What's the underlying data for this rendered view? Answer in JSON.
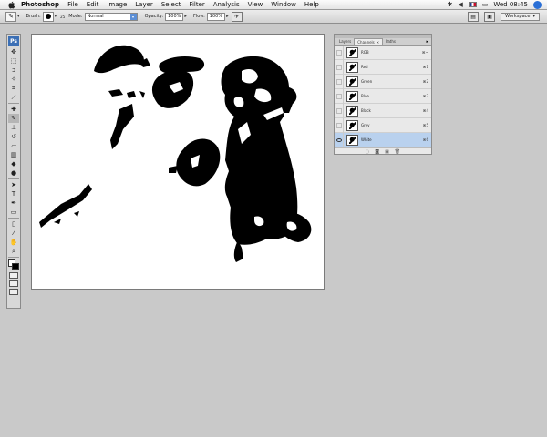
{
  "menubar": {
    "app_name": "Photoshop",
    "items": [
      "File",
      "Edit",
      "Image",
      "Layer",
      "Select",
      "Filter",
      "Analysis",
      "View",
      "Window",
      "Help"
    ],
    "clock": "Wed 08:45"
  },
  "options": {
    "brush_label": "Brush:",
    "brush_size": "25",
    "mode_label": "Mode:",
    "mode_value": "Normal",
    "opacity_label": "Opacity:",
    "opacity_value": "100%",
    "flow_label": "Flow:",
    "flow_value": "100%",
    "workspace_label": "Workspace"
  },
  "tools": {
    "logo": "Ps"
  },
  "panel": {
    "tabs": [
      "Layers",
      "Channels",
      "Paths"
    ],
    "active_tab_close": "×",
    "channels": [
      {
        "name": "RGB",
        "key": "⌘~",
        "visible": false,
        "selected": false
      },
      {
        "name": "Red",
        "key": "⌘1",
        "visible": false,
        "selected": false
      },
      {
        "name": "Green",
        "key": "⌘2",
        "visible": false,
        "selected": false
      },
      {
        "name": "Blue",
        "key": "⌘3",
        "visible": false,
        "selected": false
      },
      {
        "name": "Black",
        "key": "⌘4",
        "visible": false,
        "selected": false
      },
      {
        "name": "Grey",
        "key": "⌘5",
        "visible": false,
        "selected": false
      },
      {
        "name": "White",
        "key": "⌘6",
        "visible": true,
        "selected": true
      }
    ]
  },
  "colors": {
    "selection": "#b9d1ee",
    "ps_logo": "#3b6fb5"
  }
}
